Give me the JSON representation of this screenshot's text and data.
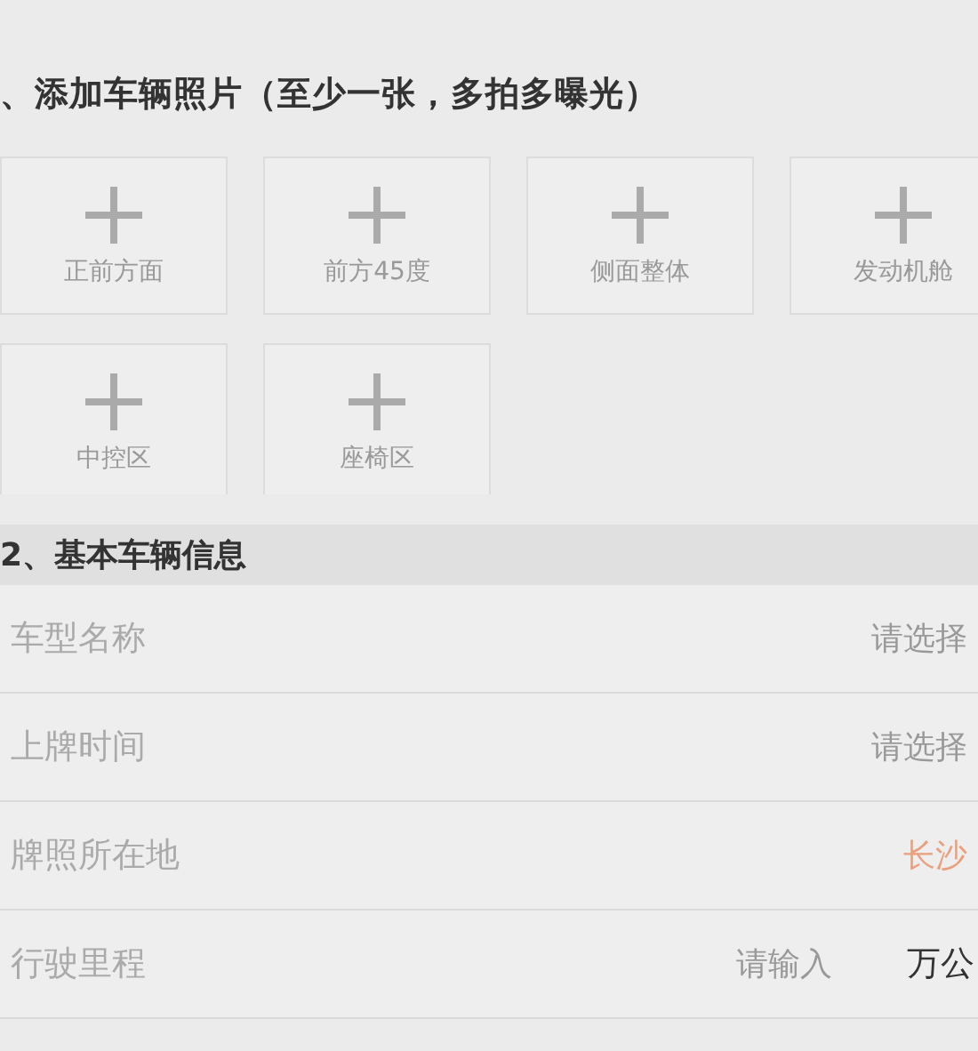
{
  "photo_section": {
    "title": "、添加车辆照片（至少一张，多拍多曝光）",
    "tiles": [
      {
        "label": "正前方面"
      },
      {
        "label": "前方45度"
      },
      {
        "label": "侧面整体"
      },
      {
        "label": "发动机舱"
      },
      {
        "label": "中控区"
      },
      {
        "label": "座椅区"
      }
    ]
  },
  "info_section": {
    "title": "2、基本车辆信息",
    "rows": [
      {
        "kind": "select",
        "label": "车型名称",
        "placeholder": "请选择"
      },
      {
        "kind": "select",
        "label": "上牌时间",
        "placeholder": "请选择"
      },
      {
        "kind": "select",
        "label": "牌照所在地",
        "value": "长沙"
      },
      {
        "kind": "input",
        "label": "行驶里程",
        "placeholder": "请输入",
        "unit": "万公"
      }
    ]
  }
}
